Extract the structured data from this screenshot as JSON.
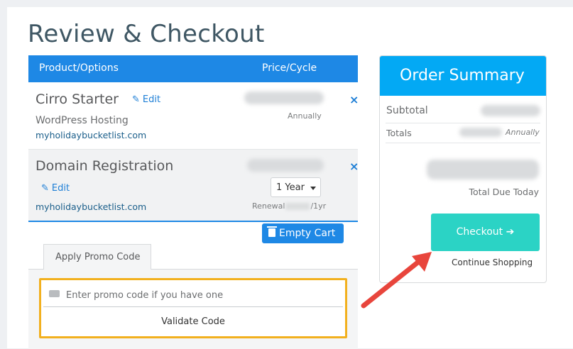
{
  "page": {
    "title": "Review & Checkout"
  },
  "cart": {
    "columns": [
      "Product/Options",
      "Price/Cycle"
    ],
    "items": [
      {
        "name": "Cirro Starter",
        "edit_label": "Edit",
        "group": "WordPress Hosting",
        "domain": "myholidaybucketlist.com",
        "cycle": "Annually",
        "remove": "×"
      },
      {
        "name": "Domain Registration",
        "edit_label": "Edit",
        "domain": "myholidaybucketlist.com",
        "term_selected": "1 Year",
        "renewal_prefix": "Renewal",
        "renewal_suffix": "/1yr",
        "remove": "×"
      }
    ],
    "empty_cart_label": "Empty Cart"
  },
  "promo": {
    "tab_label": "Apply Promo Code",
    "placeholder": "Enter promo code if you have one",
    "validate_label": "Validate Code"
  },
  "summary": {
    "title": "Order Summary",
    "subtotal_label": "Subtotal",
    "totals_label": "Totals",
    "totals_cycle": "Annually",
    "due_label": "Total Due Today",
    "checkout_label": "Checkout ➔",
    "continue_label": "Continue Shopping"
  },
  "colors": {
    "primary": "#1e88e5",
    "summary_header": "#03a9f4",
    "checkout": "#2bd3c5",
    "highlight": "#f2b01e",
    "annotation_arrow": "#e8453c"
  },
  "icons": [
    "pencil-icon",
    "close-icon",
    "trash-icon",
    "ticket-icon",
    "arrow-right-icon"
  ]
}
